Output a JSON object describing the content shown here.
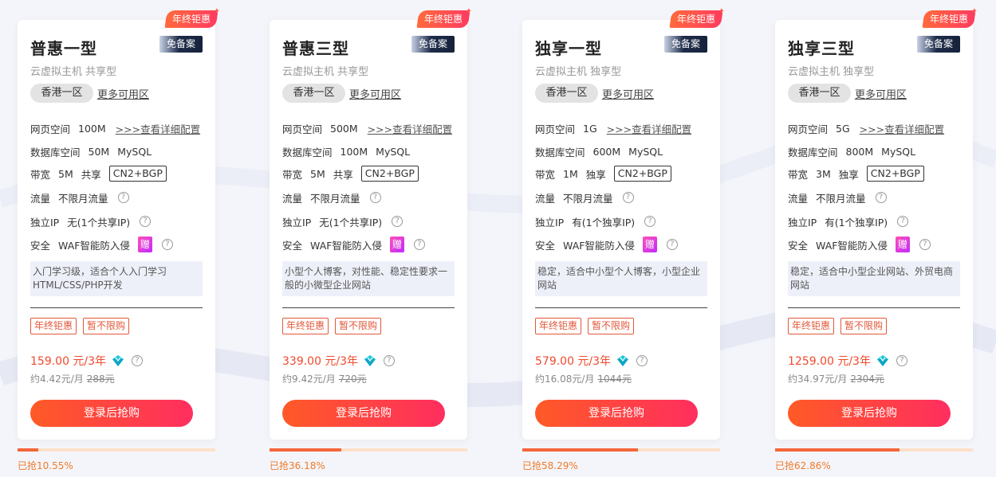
{
  "cards": [
    {
      "ribbon": "年终钜惠",
      "title": "普惠一型",
      "badge": "免备案",
      "subtitle": "云虚拟主机 共享型",
      "region": "香港一区",
      "more_regions": "更多可用区",
      "web_space_label": "网页空间",
      "web_space_value": "100M",
      "detail_link": ">>>查看详细配置",
      "db_label": "数据库空间",
      "db_value": "50M",
      "db_type": "MySQL",
      "bw_label": "带宽",
      "bw_value": "5M",
      "bw_type": "共享",
      "line_tag": "CN2+BGP",
      "traffic_label": "流量",
      "traffic_value": "不限月流量",
      "ip_label": "独立IP",
      "ip_value": "无(1个共享IP)",
      "sec_label": "安全",
      "sec_value": "WAF智能防入侵",
      "gift": "赠",
      "desc": "入门学习级，适合个人入门学习HTML/CSS/PHP开发",
      "promo1": "年终钜惠",
      "promo2": "暂不限购",
      "price": "159.00 元/3年",
      "monthly": "约4.42元/月",
      "orig_price": "288元",
      "buy": "登录后抢购",
      "progress": 0.1055,
      "sold": "已抢10.55%"
    },
    {
      "ribbon": "年终钜惠",
      "title": "普惠三型",
      "badge": "免备案",
      "subtitle": "云虚拟主机 共享型",
      "region": "香港一区",
      "more_regions": "更多可用区",
      "web_space_label": "网页空间",
      "web_space_value": "500M",
      "detail_link": ">>>查看详细配置",
      "db_label": "数据库空间",
      "db_value": "100M",
      "db_type": "MySQL",
      "bw_label": "带宽",
      "bw_value": "5M",
      "bw_type": "共享",
      "line_tag": "CN2+BGP",
      "traffic_label": "流量",
      "traffic_value": "不限月流量",
      "ip_label": "独立IP",
      "ip_value": "无(1个共享IP)",
      "sec_label": "安全",
      "sec_value": "WAF智能防入侵",
      "gift": "赠",
      "desc": "小型个人博客，对性能、稳定性要求一般的小微型企业网站",
      "promo1": "年终钜惠",
      "promo2": "暂不限购",
      "price": "339.00 元/3年",
      "monthly": "约9.42元/月",
      "orig_price": "720元",
      "buy": "登录后抢购",
      "progress": 0.3618,
      "sold": "已抢36.18%"
    },
    {
      "ribbon": "年终钜惠",
      "title": "独享一型",
      "badge": "免备案",
      "subtitle": "云虚拟主机 独享型",
      "region": "香港一区",
      "more_regions": "更多可用区",
      "web_space_label": "网页空间",
      "web_space_value": "1G",
      "detail_link": ">>>查看详细配置",
      "db_label": "数据库空间",
      "db_value": "600M",
      "db_type": "MySQL",
      "bw_label": "带宽",
      "bw_value": "1M",
      "bw_type": "独享",
      "line_tag": "CN2+BGP",
      "traffic_label": "流量",
      "traffic_value": "不限月流量",
      "ip_label": "独立IP",
      "ip_value": "有(1个独享IP)",
      "sec_label": "安全",
      "sec_value": "WAF智能防入侵",
      "gift": "赠",
      "desc": "稳定，适合中小型个人博客，小型企业网站",
      "promo1": "年终钜惠",
      "promo2": "暂不限购",
      "price": "579.00 元/3年",
      "monthly": "约16.08元/月",
      "orig_price": "1044元",
      "buy": "登录后抢购",
      "progress": 0.5829,
      "sold": "已抢58.29%"
    },
    {
      "ribbon": "年终钜惠",
      "title": "独享三型",
      "badge": "免备案",
      "subtitle": "云虚拟主机 独享型",
      "region": "香港一区",
      "more_regions": "更多可用区",
      "web_space_label": "网页空间",
      "web_space_value": "5G",
      "detail_link": ">>>查看详细配置",
      "db_label": "数据库空间",
      "db_value": "800M",
      "db_type": "MySQL",
      "bw_label": "带宽",
      "bw_value": "3M",
      "bw_type": "独享",
      "line_tag": "CN2+BGP",
      "traffic_label": "流量",
      "traffic_value": "不限月流量",
      "ip_label": "独立IP",
      "ip_value": "有(1个独享IP)",
      "sec_label": "安全",
      "sec_value": "WAF智能防入侵",
      "gift": "赠",
      "desc": "稳定，适合中小型企业网站、外贸电商网站",
      "promo1": "年终钜惠",
      "promo2": "暂不限购",
      "price": "1259.00 元/3年",
      "monthly": "约34.97元/月",
      "orig_price": "2304元",
      "buy": "登录后抢购",
      "progress": 0.6286,
      "sold": "已抢62.86%"
    }
  ],
  "colors": {
    "accent": "#f04a2e",
    "button_start": "#ff5a26",
    "button_end": "#ff2e5f",
    "progress": "#f4663a"
  },
  "icons": {
    "help": "question-circle-icon",
    "vip": "vip-diamond-icon",
    "gift": "gift-badge-icon"
  }
}
